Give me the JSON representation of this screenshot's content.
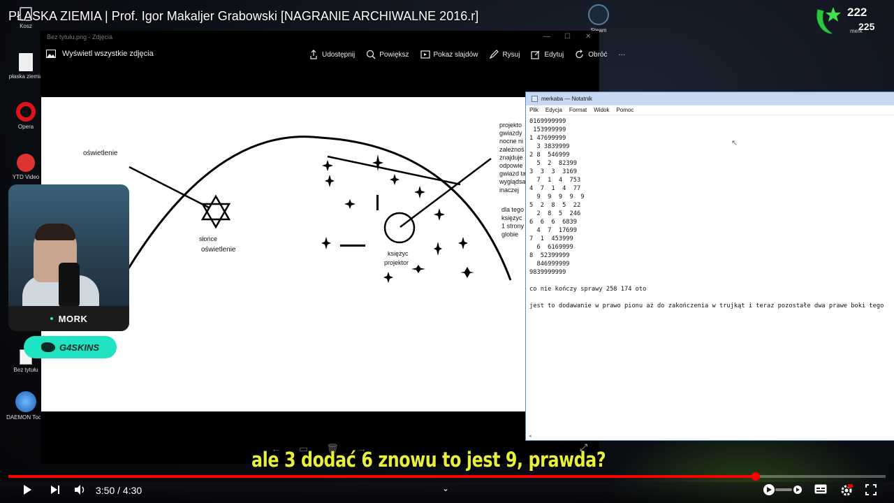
{
  "video": {
    "title": "PŁASKA ZIEMIA | Prof. Igor Makaljer Grabowski [NAGRANIE ARCHIWALNE 2016.r]",
    "subtitle": "ale 3 dodać 6 znowu to jest 9, prawda?",
    "time_current": "3:50",
    "time_separator": " / ",
    "time_total": "4:30",
    "progress_fraction": 0.852
  },
  "desktop_icons": [
    {
      "label": "Kosz",
      "icon": "recycle-bin-icon"
    },
    {
      "label": "płaska ziemia",
      "icon": "file-icon"
    },
    {
      "label": "Opera",
      "icon": "opera-icon"
    },
    {
      "label": "YTD Video",
      "icon": "ytd-icon"
    },
    {
      "label": "Bez tytułu",
      "icon": "text-file-icon"
    },
    {
      "label": "DAEMON Tools",
      "icon": "daemon-tools-icon"
    },
    {
      "label": "Steam",
      "icon": "steam-icon"
    }
  ],
  "photos": {
    "window_title": "Bez tytułu.png - Zdjęcia",
    "back_label": "Wyświetl wszystkie zdjęcia",
    "toolbar": [
      {
        "label": "Udostępnij",
        "icon": "share-icon"
      },
      {
        "label": "Powiększ",
        "icon": "zoom-icon"
      },
      {
        "label": "Pokaz slajdów",
        "icon": "slideshow-icon"
      },
      {
        "label": "Rysuj",
        "icon": "draw-icon"
      },
      {
        "label": "Edytuj",
        "icon": "edit-icon"
      },
      {
        "label": "Obróć",
        "icon": "rotate-icon"
      }
    ],
    "more_label": "···",
    "drawing": {
      "label_left_top": "oświetlenie",
      "label_sun": "słońce",
      "label_sun_light": "oświetlenie",
      "label_moon": "księżyc",
      "label_projector": "projektor",
      "right_text_lines": [
        "projekto",
        "gwiazdy",
        "nocne ni",
        "zależnoś",
        "znajduje",
        "odpowie",
        "gwiazd ta",
        "wyglądsa",
        "inaczej"
      ],
      "right_text_lines_2": [
        "dla tego",
        "księżyc",
        "1 strony",
        "globie"
      ]
    }
  },
  "notepad": {
    "title": "merkaba — Notatnik",
    "menu": [
      "Plik",
      "Edycja",
      "Format",
      "Widok",
      "Pomoc"
    ],
    "lines": [
      "0169999999",
      " 153999999",
      "1 47699999",
      "  3 3839999",
      "2 8  546999",
      "  5  2  82399",
      "3  3  3  3169",
      "  7  1  4  753",
      "4  7  1  4  77",
      "  9  9  9  9  9",
      "5  2  8  5  22",
      "  2  8  5  246",
      "6  6  6  6839",
      "  4  7  17699",
      "7  1  453999",
      "  6  6169999",
      "8  52399999",
      "  846999999",
      "9839999999",
      "",
      "co nie kończy sprawy 258 174 oto",
      "",
      "jest to dodawanie w prawo pionu aż do zakończenia w trujkąt i teraz pozostałe dwa prawe boki tego"
    ]
  },
  "webcam": {
    "name": "MORK"
  },
  "sponsor": {
    "text": "G4SKINS"
  },
  "channel": {
    "num_top": "222",
    "num_bottom": "225",
    "tag": "merk"
  }
}
